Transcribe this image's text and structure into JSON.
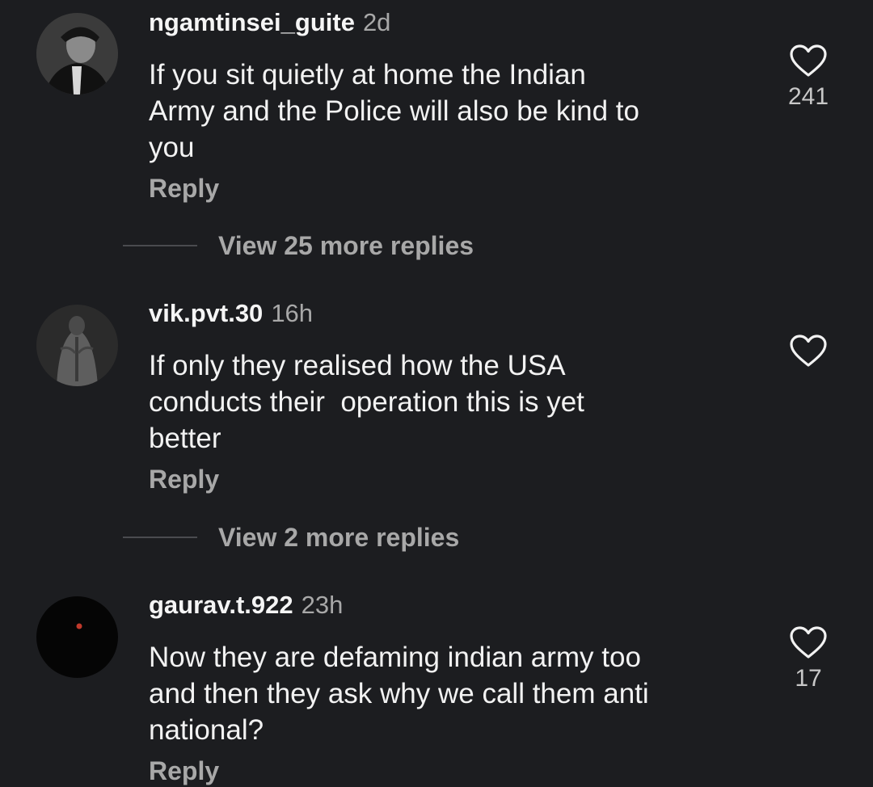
{
  "comments": [
    {
      "username": "ngamtinsei_guite",
      "time": "2d",
      "text": "If you sit quietly at home the Indian\nArmy and the Police will also be kind to\nyou",
      "reply_label": "Reply",
      "like_count": "241",
      "view_replies": "View 25 more replies",
      "avatar_icon": "avatar-photo"
    },
    {
      "username": "vik.pvt.30",
      "time": "16h",
      "text": "If only they realised how the USA\nconducts their  operation this is yet\nbetter",
      "reply_label": "Reply",
      "like_count": "",
      "view_replies": "View 2 more replies",
      "avatar_icon": "avatar-photo"
    },
    {
      "username": "gaurav.t.922",
      "time": "23h",
      "text": "Now they are defaming indian army too\nand then they ask why we call them anti\nnational?",
      "reply_label": "Reply",
      "like_count": "17",
      "avatar_icon": "avatar-photo"
    }
  ],
  "icons": {
    "like": "heart-outline-icon"
  },
  "colors": {
    "background": "#1c1d20",
    "text_primary": "#f2f2f2",
    "text_secondary": "#a8a8a8"
  }
}
